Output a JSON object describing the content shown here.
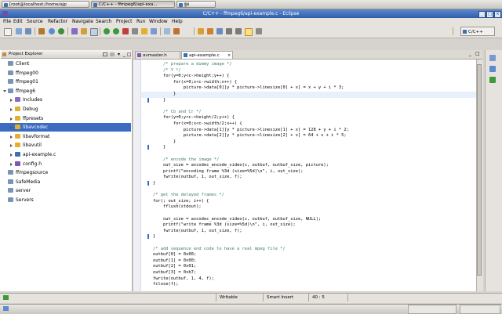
{
  "taskbar": {
    "items": [
      {
        "label": "[root@localhost:/home/ajp"
      },
      {
        "label": "C/C++ - ffmpeg6/api-exa..."
      },
      {
        "label": "ฐผ"
      }
    ]
  },
  "window": {
    "title": "C/C++ - ffmpeg6/api-example.c - Eclipse"
  },
  "menu": [
    "File",
    "Edit",
    "Source",
    "Refactor",
    "Navigate",
    "Search",
    "Project",
    "Run",
    "Window",
    "Help"
  ],
  "perspective": {
    "label": "C/C++"
  },
  "explorer": {
    "tab_label": "Project Explorer",
    "items": [
      {
        "label": "Client",
        "depth": 0,
        "expanded": false,
        "selected": false,
        "icon": "project-icon"
      },
      {
        "label": "ffmpeg00",
        "depth": 0,
        "expanded": false,
        "selected": false,
        "icon": "project-icon"
      },
      {
        "label": "ffmpeg01",
        "depth": 0,
        "expanded": false,
        "selected": false,
        "icon": "project-icon"
      },
      {
        "label": "ffmpeg6",
        "depth": 0,
        "expanded": true,
        "selected": false,
        "icon": "project-icon"
      },
      {
        "label": "Includes",
        "depth": 1,
        "expanded": false,
        "selected": false,
        "icon": "includes-icon"
      },
      {
        "label": "Debug",
        "depth": 1,
        "expanded": false,
        "selected": false,
        "icon": "folder-icon"
      },
      {
        "label": "ffpresets",
        "depth": 1,
        "expanded": false,
        "selected": false,
        "icon": "folder-icon"
      },
      {
        "label": "libavcodec",
        "depth": 1,
        "expanded": false,
        "selected": true,
        "icon": "folder-icon"
      },
      {
        "label": "libavformat",
        "depth": 1,
        "expanded": false,
        "selected": false,
        "icon": "folder-icon"
      },
      {
        "label": "libavutil",
        "depth": 1,
        "expanded": false,
        "selected": false,
        "icon": "folder-icon"
      },
      {
        "label": "api-example.c",
        "depth": 1,
        "expanded": false,
        "selected": false,
        "icon": "c-file-icon"
      },
      {
        "label": "config.h",
        "depth": 1,
        "expanded": false,
        "selected": false,
        "icon": "h-file-icon"
      },
      {
        "label": "ffmpegsource",
        "depth": 0,
        "expanded": false,
        "selected": false,
        "icon": "project-icon"
      },
      {
        "label": "SafeMedia",
        "depth": 0,
        "expanded": false,
        "selected": false,
        "icon": "project-icon"
      },
      {
        "label": "server",
        "depth": 0,
        "expanded": false,
        "selected": false,
        "icon": "project-icon"
      },
      {
        "label": "Servers",
        "depth": 0,
        "expanded": false,
        "selected": false,
        "icon": "project-icon"
      }
    ]
  },
  "editor": {
    "tabs": [
      {
        "label": "avmaster.h",
        "active": false
      },
      {
        "label": "api-example.c",
        "active": true
      }
    ],
    "lines": [
      {
        "text": "        /* prepare a dummy image */",
        "kind": "cmt"
      },
      {
        "text": "        /* Y */",
        "kind": "cmt"
      },
      {
        "text": "        for(y=0;y<c->height;y++) {",
        "kind": "code"
      },
      {
        "text": "            for(x=0;x<c->width;x++) {",
        "kind": "code"
      },
      {
        "text": "                picture->data[0][y * picture->linesize[0] + x] = x + y + i * 3;",
        "kind": "code"
      },
      {
        "text": "            }",
        "kind": "code"
      },
      {
        "text": "        }",
        "kind": "code"
      },
      {
        "text": "",
        "kind": "code"
      },
      {
        "text": "        /* Cb and Cr */",
        "kind": "cmt"
      },
      {
        "text": "        for(y=0;y<c->height/2;y++) {",
        "kind": "code"
      },
      {
        "text": "            for(x=0;x<c->width/2;x++) {",
        "kind": "code"
      },
      {
        "text": "                picture->data[1][y * picture->linesize[1] + x] = 128 + y + i * 2;",
        "kind": "code"
      },
      {
        "text": "                picture->data[2][y * picture->linesize[2] + x] = 64 + x + i * 5;",
        "kind": "code"
      },
      {
        "text": "            }",
        "kind": "code"
      },
      {
        "text": "        }",
        "kind": "code"
      },
      {
        "text": "",
        "kind": "code"
      },
      {
        "text": "        /* encode the image */",
        "kind": "cmt"
      },
      {
        "text": "        out_size = avcodec_encode_video(c, outbuf, outbuf_size, picture);",
        "kind": "code"
      },
      {
        "text": "        printf(\"encoding frame %3d (size=%5d)\\n\", i, out_size);",
        "kind": "code"
      },
      {
        "text": "        fwrite(outbuf, 1, out_size, f);",
        "kind": "code"
      },
      {
        "text": "    }",
        "kind": "code"
      },
      {
        "text": "",
        "kind": "code"
      },
      {
        "text": "    /* get the delayed frames */",
        "kind": "cmt"
      },
      {
        "text": "    for(; out_size; i++) {",
        "kind": "code"
      },
      {
        "text": "        fflush(stdout);",
        "kind": "code"
      },
      {
        "text": "",
        "kind": "code"
      },
      {
        "text": "        out_size = avcodec_encode_video(c, outbuf, outbuf_size, NULL);",
        "kind": "code"
      },
      {
        "text": "        printf(\"write frame %3d (size=%5d)\\n\", i, out_size);",
        "kind": "code"
      },
      {
        "text": "        fwrite(outbuf, 1, out_size, f);",
        "kind": "code"
      },
      {
        "text": "    }",
        "kind": "code"
      },
      {
        "text": "",
        "kind": "code"
      },
      {
        "text": "    /* add sequence end code to have a real mpeg file */",
        "kind": "cmt"
      },
      {
        "text": "    outbuf[0] = 0x00;",
        "kind": "code"
      },
      {
        "text": "    outbuf[1] = 0x00;",
        "kind": "code"
      },
      {
        "text": "    outbuf[2] = 0x01;",
        "kind": "code"
      },
      {
        "text": "    outbuf[3] = 0xb7;",
        "kind": "code"
      },
      {
        "text": "    fwrite(outbuf, 1, 4, f);",
        "kind": "code"
      },
      {
        "text": "    fclose(f);",
        "kind": "code"
      }
    ]
  },
  "status": {
    "writable": "Writable",
    "insert_mode": "Smart Insert",
    "position": "40 : 5"
  },
  "bottom_bar": {
    "left": "",
    "right": ""
  },
  "colors": {
    "title_bar": "#3b6cc2",
    "selection": "#3b6cc2",
    "comment": "#3f7f5f",
    "keyword": "#7f0055",
    "current_line": "#e8f0fc"
  }
}
